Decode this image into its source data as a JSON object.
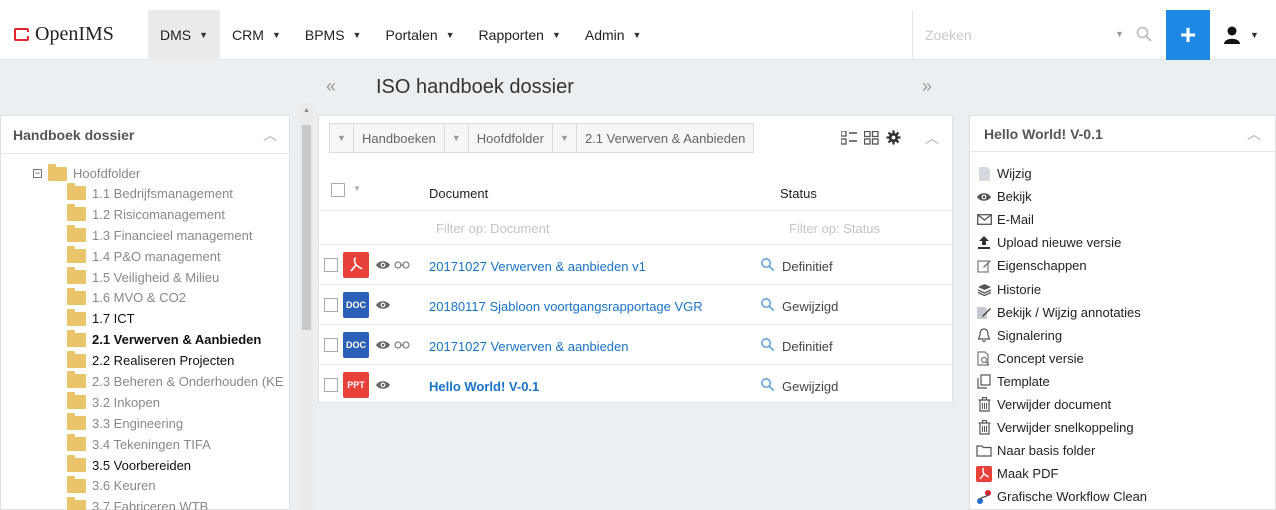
{
  "app": {
    "brand": "OpenIMS"
  },
  "nav": {
    "items": [
      {
        "label": "DMS",
        "active": true
      },
      {
        "label": "CRM"
      },
      {
        "label": "BPMS"
      },
      {
        "label": "Portalen"
      },
      {
        "label": "Rapporten"
      },
      {
        "label": "Admin"
      }
    ],
    "search_placeholder": "Zoeken",
    "plus_label": "+"
  },
  "page": {
    "title": "ISO handboek dossier",
    "prev": "«",
    "next": "»"
  },
  "tree_panel": {
    "title": "Handboek dossier",
    "root": "Hoofdfolder",
    "items": [
      {
        "label": "1.1 Bedrijfsmanagement"
      },
      {
        "label": "1.2 Risicomanagement"
      },
      {
        "label": "1.3 Financieel management"
      },
      {
        "label": "1.4 P&O management"
      },
      {
        "label": "1.5 Veiligheid & Milieu"
      },
      {
        "label": "1.6 MVO & CO2"
      },
      {
        "label": "1.7 ICT"
      },
      {
        "label": "2.1 Verwerven & Aanbieden"
      },
      {
        "label": "2.2 Realiseren Projecten"
      },
      {
        "label": "2.3 Beheren & Onderhouden (KE"
      },
      {
        "label": "3.2 Inkopen"
      },
      {
        "label": "3.3 Engineering"
      },
      {
        "label": "3.4 Tekeningen TIFA"
      },
      {
        "label": "3.5 Voorbereiden"
      },
      {
        "label": "3.6 Keuren"
      },
      {
        "label": "3.7 Fabriceren WTB"
      }
    ]
  },
  "doc_panel": {
    "breadcrumb": [
      "Handboeken",
      "Hoofdfolder",
      "2.1 Verwerven & Aanbieden"
    ],
    "columns": {
      "document": "Document",
      "status": "Status"
    },
    "filters": {
      "document": "Filter op: Document",
      "status": "Filter op: Status"
    },
    "rows": [
      {
        "type": "pdf",
        "type_label": "",
        "name": "20171027 Verwerven & aanbieden v1",
        "status": "Definitief"
      },
      {
        "type": "doc",
        "type_label": "DOC",
        "name": "20180117 Sjabloon voortgangsrapportage VGR",
        "status": "Gewijzigd"
      },
      {
        "type": "doc",
        "type_label": "DOC",
        "name": "20171027 Verwerven & aanbieden",
        "status": "Definitief"
      },
      {
        "type": "ppt",
        "type_label": "PPT",
        "name": "Hello World! V-0.1",
        "status": "Gewijzigd"
      }
    ]
  },
  "action_panel": {
    "title": "Hello World! V-0.1",
    "actions": [
      {
        "label": "Wijzig",
        "icon": "file-icon"
      },
      {
        "label": "Bekijk",
        "icon": "eye-icon"
      },
      {
        "label": "E-Mail",
        "icon": "envelope-icon"
      },
      {
        "label": "Upload nieuwe versie",
        "icon": "upload-icon"
      },
      {
        "label": "Eigenschappen",
        "icon": "edit-icon"
      },
      {
        "label": "Historie",
        "icon": "layers-icon"
      },
      {
        "label": "Bekijk / Wijzig annotaties",
        "icon": "annotate-icon"
      },
      {
        "label": "Signalering",
        "icon": "bell-icon"
      },
      {
        "label": "Concept versie",
        "icon": "concept-icon"
      },
      {
        "label": "Template",
        "icon": "template-icon"
      },
      {
        "label": "Verwijder document",
        "icon": "trash-icon"
      },
      {
        "label": "Verwijder snelkoppeling",
        "icon": "trash-icon"
      },
      {
        "label": "Naar basis folder",
        "icon": "folder-icon"
      },
      {
        "label": "Maak PDF",
        "icon": "pdf-icon"
      },
      {
        "label": "Grafische Workflow Clean",
        "icon": "workflow-icon"
      }
    ]
  }
}
